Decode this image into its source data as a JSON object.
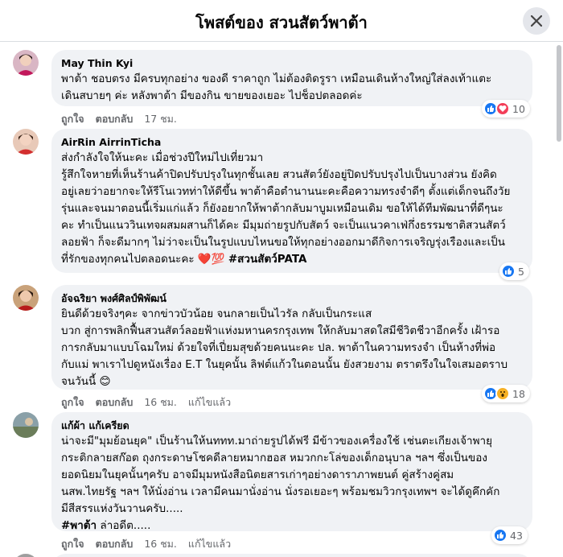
{
  "header": {
    "title": "โพสต์ของ สวนสัตว์พาต้า"
  },
  "labels": {
    "like": "ถูกใจ",
    "reply": "ตอบกลับ",
    "edited": "แก้ไขแล้ว"
  },
  "comments": [
    {
      "author": "May Thin Kyi",
      "lines": [
        "พาต้า ชอบตรง มีครบทุกอย่าง ของดี ราคาถูก ไม่ต้องติดรูรา เหมือนเดินห้างใหญ่ใส่ลงเท้าแตะ",
        "เดินสบายๆ ค่ะ หลังพาต้า มีของกิน ขายของเยอะ ไปช็อปตลอดค่ะ"
      ],
      "time": "17 ชม.",
      "reaction_count": "10",
      "reactions": [
        "like",
        "love"
      ]
    },
    {
      "author": "AirRin AirrinTicha",
      "lines": [
        "ส่งกำลังใจให้นะคะ เมื่อช่วงปีใหม่ไปเที่ยวมา",
        "รู้สึกใจหายที่เห็นร้านค้าปิดปรับปรุงในทุกชั้นเลย สวนสัตว์ยังอยู่ปิดปรับปรุงไปเป็นบางส่วน ยังคิด",
        "อยู่เลยว่าอยากจะให้รีโนเวทท่าให้ดีขึ้น พาต้าคือตำนานนะคะคือความทรงจำดีๆ ตั้งแต่เด็กจนถึงวัย",
        "รุ่นและจนมาตอนนี้เริ่มแก่แล้ว ก็ยังอยากให้พาต้ากลับมาบูมเหมือนเดิม ขอให้ได้ทีมพัฒนาที่ดีๆนะ",
        "คะ ทำเป็นแนววินเทจผสมผสานก็ได้คะ มีมุมถ่ายรูปกับสัตว์ จะเป็นแนวคาเฟ่กึ่งธรรมชาติสวนสัตว์",
        "ลอยฟ้า ก็จะดีมากๆ ไม่ว่าจะเป็นในรูปแบบไหนขอให้ทุกอย่างออกมาดีกิจการเจริญรุ่งเรืองและเป็น"
      ],
      "last_line": "ที่รักของทุกคนไปตลอดนะคะ",
      "emoji": "❤️💯",
      "hashtag": "#สวนสัตว์PATA",
      "time": "",
      "reaction_count": "5",
      "reactions": [
        "like"
      ]
    },
    {
      "author": "อัจฉริยา พงศ์ศิลป์พิพัฒน์",
      "lines": [
        "ยินดีด้วยจริงๆคะ จากข่าวบัวน้อย จนกลายเป็นไวรัล กลับเป็นกระแส",
        "บวก สู่การพลิกฟื้นสวนสัตว์ลอยฟ้าแห่งมหานครกรุงเทพ ให้กลับมาสดใสมีชีวิตชีวาอีกครั้ง เฝ้ารอ",
        "การกลับมาแบบโฉมใหม่ ด้วยใจที่เปี่ยมสุขด้วยคนนะคะ ปล. พาต้าในความทรงจำ เป็นห้างที่พ่อ",
        "กับแม่ พาเราไปดูหนังเรื่อง E.T ในยุคนั้น ลิฟต์แก้วในตอนนั้น ยังสวยงาม ตราตรึงในใจเสมอตราบ",
        "จนวันนี้ 😊"
      ],
      "time": "16 ชม.",
      "reaction_count": "18",
      "reactions": [
        "like",
        "wow"
      ]
    },
    {
      "author": "แก้ผ้า แก้เครียด",
      "lines": [
        "น่าจะมี\"มุมย้อนยุค\" เป็นร้านให้นททท.มาถ่ายรูปได้ฟรี มีข้าวของเครื่องใช้ เช่นตะเกียงเจ้าพายุ",
        "กระติกลายสก๊อต ถุงกระดาษโชคดีลายหมากฮอส หมวกกะโล่ของเด็กอนุบาล ฯลฯ ซึ่งเป็นของ",
        "ยอดนิยมในยุคนั้นๆครับ อาจมีมุมหนังสือนิตยสารเก่าๆอย่างดาราภาพยนต์ คู่สร้างคู่สม",
        "นสพ.ไทยรัฐ ฯลฯ ให้นั่งอ่าน เวลามีคนมานั่งอ่าน นั่งรอเยอะๆ พร้อมชมวิวกรุงเทพฯ จะได้ดูคึกคัก",
        "มีสีสรรแห่งวันวานครับ....."
      ],
      "hashtag": "#พาต้า",
      "hashtag_suffix": " ล่าอดีต.....",
      "time": "16 ชม.",
      "reaction_count": "43",
      "reactions": [
        "like"
      ]
    }
  ],
  "colors": {
    "like": "#1877f2",
    "love": "#f33e58",
    "wow": "#f7b125",
    "bubble": "#f0f2f5",
    "secondary": "#65676b"
  },
  "icons": {
    "close": "close-icon",
    "like": "like-icon",
    "love": "love-icon",
    "wow": "wow-icon",
    "smile": "smile-emoji"
  }
}
